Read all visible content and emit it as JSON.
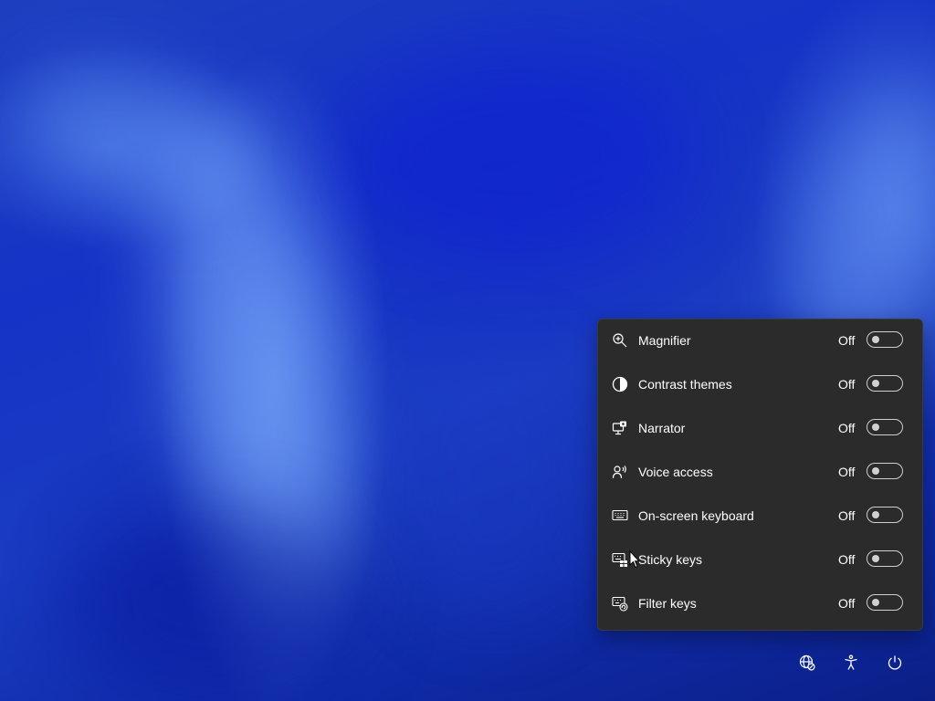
{
  "accessibility_panel": {
    "items": [
      {
        "icon": "magnifier-icon",
        "label": "Magnifier",
        "state": "Off"
      },
      {
        "icon": "contrast-themes-icon",
        "label": "Contrast themes",
        "state": "Off"
      },
      {
        "icon": "narrator-icon",
        "label": "Narrator",
        "state": "Off"
      },
      {
        "icon": "voice-access-icon",
        "label": "Voice access",
        "state": "Off"
      },
      {
        "icon": "on-screen-keyboard-icon",
        "label": "On-screen keyboard",
        "state": "Off"
      },
      {
        "icon": "sticky-keys-icon",
        "label": "Sticky keys",
        "state": "Off"
      },
      {
        "icon": "filter-keys-icon",
        "label": "Filter keys",
        "state": "Off"
      }
    ]
  },
  "tray": {
    "buttons": [
      {
        "icon": "network-icon"
      },
      {
        "icon": "accessibility-icon"
      },
      {
        "icon": "power-icon"
      }
    ]
  },
  "colors": {
    "panel_background": "#2b2b2b",
    "text": "#ffffff",
    "toggle_off": "#cfcfcf",
    "wallpaper_primary": "#1533c6"
  }
}
